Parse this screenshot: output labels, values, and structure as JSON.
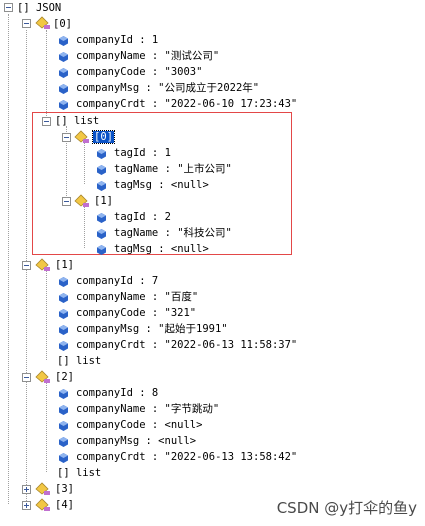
{
  "colors": {
    "highlight_border": "#e34848",
    "selection": "#0a53c7"
  },
  "root": {
    "label": "[] JSON"
  },
  "item0": {
    "label": "[0]",
    "fields": [
      "companyId : 1",
      "companyName : \"测试公司\"",
      "companyCode : \"3003\"",
      "companyMsg : \"公司成立于2022年\"",
      "companyCrdt : \"2022-06-10 17:23:43\""
    ],
    "list": {
      "label": "[] list",
      "items": [
        {
          "label": "[0]",
          "fields": [
            "tagId : 1",
            "tagName : \"上市公司\"",
            "tagMsg : <null>"
          ]
        },
        {
          "label": "[1]",
          "fields": [
            "tagId : 2",
            "tagName : \"科技公司\"",
            "tagMsg : <null>"
          ]
        }
      ]
    }
  },
  "item1": {
    "label": "[1]",
    "fields": [
      "companyId : 7",
      "companyName : \"百度\"",
      "companyCode : \"321\"",
      "companyMsg : \"起始于1991\"",
      "companyCrdt : \"2022-06-13 11:58:37\""
    ],
    "list_label": "[] list"
  },
  "item2": {
    "label": "[2]",
    "fields": [
      "companyId : 8",
      "companyName : \"字节跳动\"",
      "companyCode : <null>",
      "companyMsg : <null>",
      "companyCrdt : \"2022-06-13 13:58:42\""
    ],
    "list_label": "[] list"
  },
  "item3": {
    "label": "[3]"
  },
  "item4": {
    "label": "[4]"
  },
  "icons": {
    "object": "object-node-icon",
    "value": "value-cube-icon"
  },
  "watermark": "CSDN @y打伞的鱼y"
}
